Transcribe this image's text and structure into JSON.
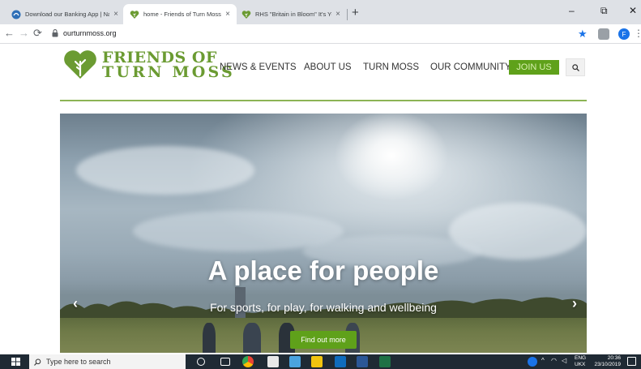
{
  "browser": {
    "tabs": [
      {
        "title": "Download our Banking App | Na",
        "close": "×"
      },
      {
        "title": "home - Friends of Turn Moss",
        "close": "×"
      },
      {
        "title": "RHS \"Britain in Bloom\" It's Your",
        "close": "×"
      }
    ],
    "new_tab": "+",
    "window_controls": {
      "minimize": "–",
      "maximize": "⧉",
      "close": "✕"
    },
    "url": "ourturnmoss.org",
    "profile_initial": "F",
    "accent_color": "#1a73e8"
  },
  "site": {
    "logo_line1": "FRIENDS OF",
    "logo_line2": "TURN MOSS",
    "brand_color": "#6b9b32",
    "nav": [
      "NEWS & EVENTS",
      "ABOUT US",
      "TURN MOSS",
      "OUR COMMUNITY"
    ],
    "join_label": "JOIN US",
    "join_color": "#5fa11a"
  },
  "hero": {
    "title": "A place for people",
    "subtitle": "For sports, for play, for walking and wellbeing",
    "cta": "Find out more",
    "prev_arrow": "‹",
    "next_arrow": "›"
  },
  "taskbar": {
    "search_placeholder": "Type here to search",
    "language": "ENG",
    "region": "UKX",
    "time": "20:36",
    "date": "23/10/2019"
  }
}
